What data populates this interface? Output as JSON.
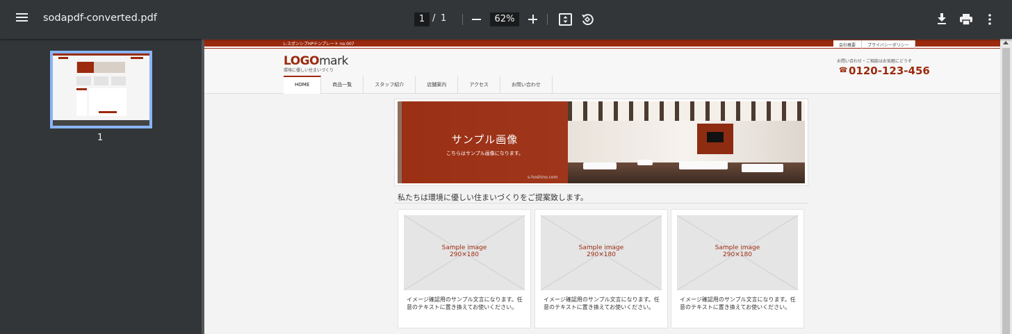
{
  "toolbar": {
    "title": "sodapdf-converted.pdf",
    "page_current": "1",
    "page_separator": "/",
    "page_total": "1",
    "zoom": "62%"
  },
  "sidebar": {
    "thumbnail_label": "1"
  },
  "document": {
    "top_tag": "レスポンシブHPテンプレート no.007",
    "top_links": [
      "会社概要",
      "プライバシーポリシー"
    ],
    "logo_main": "LOGO",
    "logo_mark": "mark",
    "logo_sub": "環境に優しい住まいづくり",
    "contact_label": "お問い合わせ・ご相談はお気軽にどうぞ",
    "phone": "0120-123-456",
    "nav": [
      "HOME",
      "商品一覧",
      "スタッフ紹介",
      "店舗案内",
      "アクセス",
      "お問い合わせ"
    ],
    "hero_title": "サンプル画像",
    "hero_sub": "こちらはサンプル画像になります。",
    "hero_credit": "s-hoshino.com",
    "intro": "私たちは環境に優しい住まいづくりをご提案致します。",
    "cards": [
      {
        "image_label_1": "Sample image",
        "image_label_2": "290×180",
        "text": "イメージ確認用のサンプル文言になります。任意のテキストに置き換えてお使いください。"
      },
      {
        "image_label_1": "Sample image",
        "image_label_2": "290×180",
        "text": "イメージ確認用のサンプル文言になります。任意のテキストに置き換えてお使いください。"
      },
      {
        "image_label_1": "Sample image",
        "image_label_2": "290×180",
        "text": "イメージ確認用のサンプル文言になります。任意のテキストに置き換えてお使いください。"
      }
    ]
  },
  "icons": [
    "menu-icon",
    "fit-page-icon",
    "rotate-icon",
    "download-icon",
    "print-icon",
    "more-vert-icon",
    "phone-icon"
  ],
  "colors": {
    "toolbar": "#323639",
    "viewer": "#525659",
    "accent_red": "#9b2a0e",
    "thumbnail_border": "#8ab4f8"
  }
}
